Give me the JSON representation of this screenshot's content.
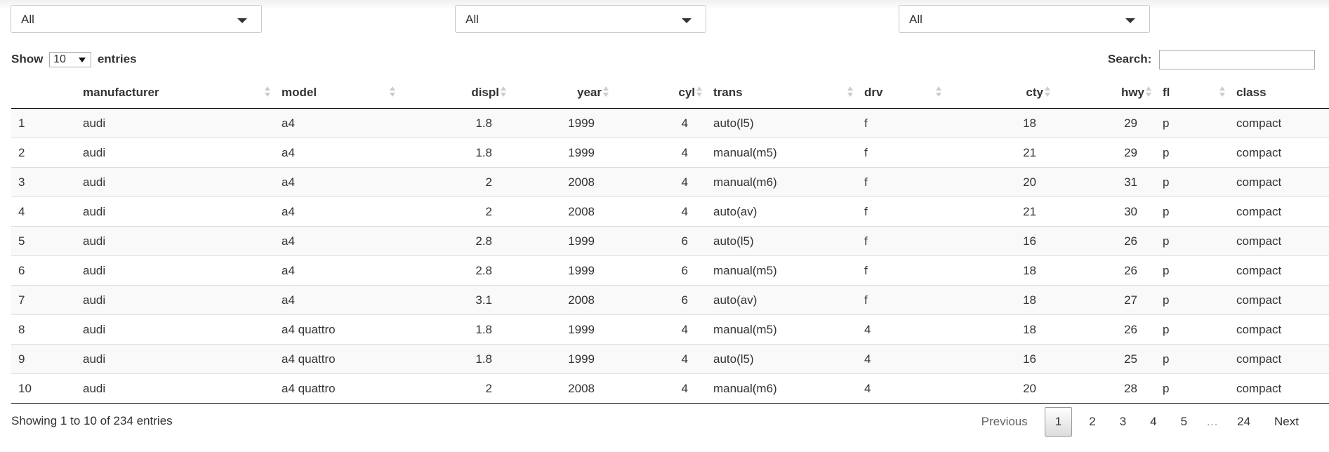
{
  "filters": [
    {
      "value": "All"
    },
    {
      "value": "All"
    },
    {
      "value": "All"
    }
  ],
  "length": {
    "show": "Show",
    "value": "10",
    "entries": "entries"
  },
  "search": {
    "label": "Search:",
    "value": ""
  },
  "columns": [
    "",
    "manufacturer",
    "model",
    "displ",
    "year",
    "cyl",
    "trans",
    "drv",
    "cty",
    "hwy",
    "fl",
    "class"
  ],
  "rows": [
    [
      "1",
      "audi",
      "a4",
      "1.8",
      "1999",
      "4",
      "auto(l5)",
      "f",
      "18",
      "29",
      "p",
      "compact"
    ],
    [
      "2",
      "audi",
      "a4",
      "1.8",
      "1999",
      "4",
      "manual(m5)",
      "f",
      "21",
      "29",
      "p",
      "compact"
    ],
    [
      "3",
      "audi",
      "a4",
      "2",
      "2008",
      "4",
      "manual(m6)",
      "f",
      "20",
      "31",
      "p",
      "compact"
    ],
    [
      "4",
      "audi",
      "a4",
      "2",
      "2008",
      "4",
      "auto(av)",
      "f",
      "21",
      "30",
      "p",
      "compact"
    ],
    [
      "5",
      "audi",
      "a4",
      "2.8",
      "1999",
      "6",
      "auto(l5)",
      "f",
      "16",
      "26",
      "p",
      "compact"
    ],
    [
      "6",
      "audi",
      "a4",
      "2.8",
      "1999",
      "6",
      "manual(m5)",
      "f",
      "18",
      "26",
      "p",
      "compact"
    ],
    [
      "7",
      "audi",
      "a4",
      "3.1",
      "2008",
      "6",
      "auto(av)",
      "f",
      "18",
      "27",
      "p",
      "compact"
    ],
    [
      "8",
      "audi",
      "a4 quattro",
      "1.8",
      "1999",
      "4",
      "manual(m5)",
      "4",
      "18",
      "26",
      "p",
      "compact"
    ],
    [
      "9",
      "audi",
      "a4 quattro",
      "1.8",
      "1999",
      "4",
      "auto(l5)",
      "4",
      "16",
      "25",
      "p",
      "compact"
    ],
    [
      "10",
      "audi",
      "a4 quattro",
      "2",
      "2008",
      "4",
      "manual(m6)",
      "4",
      "20",
      "28",
      "p",
      "compact"
    ]
  ],
  "info": "Showing 1 to 10 of 234 entries",
  "pagination": {
    "previous": "Previous",
    "pages": [
      "1",
      "2",
      "3",
      "4",
      "5"
    ],
    "ellipsis": "…",
    "last": "24",
    "next": "Next",
    "current": "1"
  }
}
